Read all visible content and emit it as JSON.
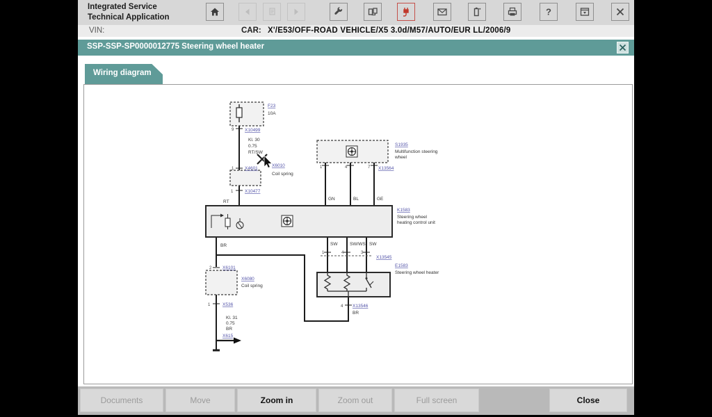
{
  "header": {
    "title_line1": "Integrated Service",
    "title_line2": "Technical Application"
  },
  "toolbar": {
    "icons": [
      {
        "name": "home",
        "enabled": true
      },
      {
        "name": "back-arrow",
        "enabled": false
      },
      {
        "name": "page",
        "enabled": false
      },
      {
        "name": "forward-arrow",
        "enabled": false
      },
      {
        "name": "wrench",
        "enabled": true
      },
      {
        "name": "devices",
        "enabled": true
      },
      {
        "name": "plug",
        "enabled": true,
        "accent": "#c0392b"
      },
      {
        "name": "envelope",
        "enabled": true
      },
      {
        "name": "battery",
        "enabled": true
      },
      {
        "name": "printer",
        "enabled": true
      },
      {
        "name": "help",
        "enabled": true
      },
      {
        "name": "window-restore",
        "enabled": true
      },
      {
        "name": "window-close",
        "enabled": true
      }
    ],
    "help_glyph": "?"
  },
  "vin": {
    "label": "VIN:",
    "car_label": "CAR:",
    "car_value": "X'/E53/OFF-ROAD VEHICLE/X5 3.0d/M57/AUTO/EUR LL/2006/9"
  },
  "tealbar": {
    "title": "SSP-SSP-SP0000012775 Steering wheel heater"
  },
  "tab": {
    "label": "Wiring diagram"
  },
  "colors": {
    "teal": "#5f9b98",
    "red_accent": "#c0392b",
    "link_blue": "#5253a8"
  },
  "diagram": {
    "fuse": {
      "code": "F23",
      "rating": "10A",
      "pin": "9",
      "connector": "X10499",
      "info1": "Kl. 30",
      "info2": "0.75",
      "info3": "RT/SW"
    },
    "cut": {
      "pin": "1",
      "connector": "X4601",
      "code": "X6010",
      "name": "Coil spring"
    },
    "coil_upper": {
      "pin": "1",
      "connector": "X10477",
      "wire": "RT"
    },
    "control_unit": {
      "code": "K1583",
      "name1": "Steering wheel",
      "name2": "heating control unit"
    },
    "mfl": {
      "code": "S1935",
      "name1": "Multifunction steering",
      "name2": "wheel",
      "pin1": "1",
      "pin2": "4",
      "pin3": "7",
      "connector": "X13564",
      "wire1": "GN",
      "wire2": "BL",
      "wire3": "GE"
    },
    "cu_out": {
      "wire1": "SW",
      "wire2": "SW/WS",
      "wire3": "SW",
      "pin1": "1",
      "pin2": "4",
      "pin3": "3",
      "connector": "X13545"
    },
    "heater": {
      "code": "E1583",
      "name": "Steering wheel heater",
      "pin": "4",
      "connector": "X13546",
      "wire": "BR"
    },
    "left_wire": "BR",
    "coil_lower": {
      "pin_top": "2",
      "connector_top": "X6101",
      "code": "X6080",
      "name": "Coil spring",
      "pin_bottom": "1",
      "connector_bottom": "X536",
      "info1": "Kl. 31",
      "info2": "0.75",
      "info3": "BR",
      "ground": "X615"
    }
  },
  "footer": {
    "buttons": [
      {
        "label": "Documents",
        "enabled": false
      },
      {
        "label": "Move",
        "enabled": false
      },
      {
        "label": "Zoom in",
        "enabled": true
      },
      {
        "label": "Zoom out",
        "enabled": false
      },
      {
        "label": "Full screen",
        "enabled": false
      },
      {
        "label": "Close",
        "enabled": true
      }
    ]
  }
}
